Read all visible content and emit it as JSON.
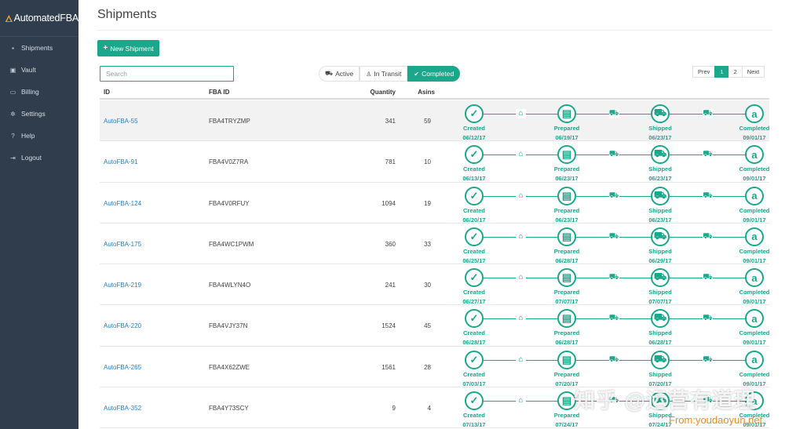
{
  "sidebar": {
    "logo": "AutomatedFBA",
    "items": [
      {
        "label": "Shipments",
        "icon": "box-icon"
      },
      {
        "label": "Vault",
        "icon": "vault-icon"
      },
      {
        "label": "Billing",
        "icon": "credit-card-icon"
      },
      {
        "label": "Settings",
        "icon": "gear-icon"
      },
      {
        "label": "Help",
        "icon": "question-icon"
      },
      {
        "label": "Logout",
        "icon": "logout-icon"
      }
    ]
  },
  "page": {
    "title": "Shipments",
    "new_button": "New Shipment",
    "search_placeholder": "Search"
  },
  "filters": [
    {
      "label": "Active",
      "icon": "truck-icon",
      "active": false
    },
    {
      "label": "In Transit",
      "icon": "person-icon",
      "active": false
    },
    {
      "label": "Completed",
      "icon": "check-icon",
      "active": true
    }
  ],
  "pager": {
    "prev": "Prev",
    "pages": [
      "1",
      "2"
    ],
    "current": "1",
    "next": "Next"
  },
  "columns": {
    "id": "ID",
    "fba_id": "FBA ID",
    "quantity": "Quantity",
    "asins": "Asins"
  },
  "steps": [
    "Created",
    "Prepared",
    "Shipped",
    "Completed"
  ],
  "rows": [
    {
      "id": "AutoFBA-55",
      "fba": "FBA4TRYZMP",
      "qty": "341",
      "asins": "59",
      "dates": [
        "06/12/17",
        "06/19/17",
        "06/23/17",
        "09/01/17"
      ]
    },
    {
      "id": "AutoFBA-91",
      "fba": "FBA4V0Z7RA",
      "qty": "781",
      "asins": "10",
      "dates": [
        "06/13/17",
        "06/23/17",
        "06/23/17",
        "09/01/17"
      ]
    },
    {
      "id": "AutoFBA-124",
      "fba": "FBA4V0RFUY",
      "qty": "1094",
      "asins": "19",
      "dates": [
        "06/20/17",
        "06/23/17",
        "06/23/17",
        "09/01/17"
      ]
    },
    {
      "id": "AutoFBA-175",
      "fba": "FBA4WC1PWM",
      "qty": "360",
      "asins": "33",
      "dates": [
        "06/25/17",
        "06/28/17",
        "06/29/17",
        "09/01/17"
      ]
    },
    {
      "id": "AutoFBA-219",
      "fba": "FBA4WLYN4O",
      "qty": "241",
      "asins": "30",
      "dates": [
        "06/27/17",
        "07/07/17",
        "07/07/17",
        "09/01/17"
      ]
    },
    {
      "id": "AutoFBA-220",
      "fba": "FBA4VJY37N",
      "qty": "1524",
      "asins": "45",
      "dates": [
        "06/28/17",
        "06/28/17",
        "06/28/17",
        "09/01/17"
      ]
    },
    {
      "id": "AutoFBA-265",
      "fba": "FBA4X62ZWE",
      "qty": "1561",
      "asins": "28",
      "dates": [
        "07/03/17",
        "07/20/17",
        "07/20/17",
        "09/01/17"
      ]
    },
    {
      "id": "AutoFBA-352",
      "fba": "FBA4Y73SCY",
      "qty": "9",
      "asins": "4",
      "dates": [
        "07/13/17",
        "07/24/17",
        "07/24/17",
        "09/01/17"
      ]
    }
  ],
  "watermark": {
    "text": "知乎 @运营有道理",
    "url": "From:youdaoyun.net"
  },
  "colors": {
    "accent": "#1aa78a",
    "sidebar": "#2f3d4c",
    "link": "#2a7fc1"
  }
}
